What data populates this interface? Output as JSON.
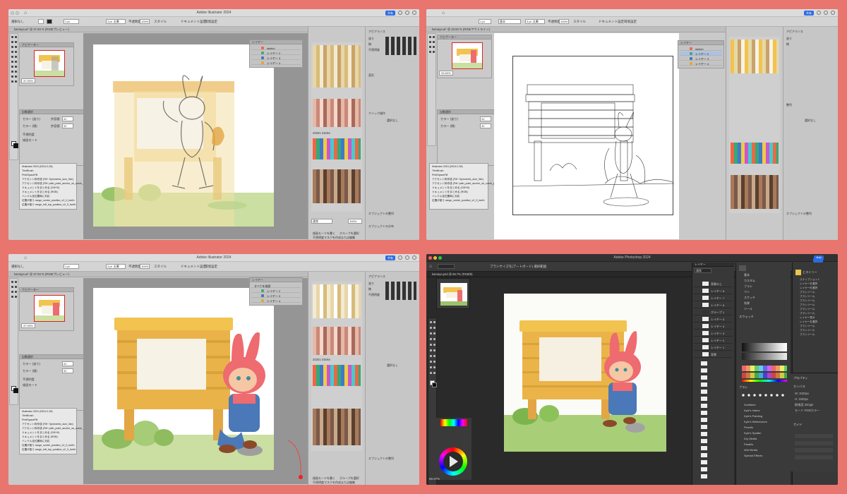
{
  "illustrator": {
    "app_title": "Adobe Illustrator 2024",
    "share_label": "共有",
    "selection_label": "選択なし",
    "stroke_value": "1 pt",
    "brush_label": "3 pt. 丸筆",
    "opacity_label": "不透明度",
    "opacity_value": "100%",
    "style_label": "スタイル",
    "doc_settings": "ドキュメント設定",
    "env_settings": "環境設定",
    "w2_stroke_label": "基本",
    "tab_label": "kamaya.ai* @ 37.93 % (RGB/プレビュー)",
    "tab_label_w2": "kamaya.ai* @ 33.83 % (RGB/アウトライン)",
    "nav_title": "ナビゲーター",
    "zoom_w1": "37.93%",
    "zoom_w2": "33.83%",
    "zoom_w3": "37.93%",
    "color_panel_title": "自動選択",
    "color_row1": "カラー (塗り)",
    "color_row2": "カラー (線)",
    "tolerance": "許容値",
    "tol1": "41",
    "tol2": "32",
    "opt1": "不透明度",
    "opt2": "描画モード",
    "layers_title": "レイヤー",
    "layers": [
      "sketch",
      "レイヤー 2",
      "レイヤー 3",
      "レイヤー 4"
    ],
    "layers_w3": [
      "すべてを検索",
      "レイヤー 2",
      "レイヤー 3",
      "レイヤー 4"
    ],
    "history": [
      "Illustrator 2024 (2024-2-28)",
      "TrimBrush",
      "PrintSpaceFill",
      "アクセント枠作成 (Fill+ Symmetric_size_3ke)",
      "アクセント枠作成 (Fill+ path_point_anchor_ok_curve_position)",
      "ドキュメントをまとめる (CMYK)",
      "ドキュメントをまとめる (RGB)",
      "ハンドル定位置時に対応",
      "位置が揃う range_centre_position_v2_0_berth",
      "位置が揃う range_left_top_position_v2_0_berth",
      "画像トレース"
    ],
    "props": {
      "section": "アピアランス",
      "fill": "塗り",
      "stroke": "線",
      "opacity_row": "不透明度",
      "transform": "変形",
      "align": "整列",
      "quick_actions": "クイック操作",
      "group_edit": "描画モードを書く",
      "group_btn": "グループを選択",
      "mask_btn": "不透明度マスクを作成または編集",
      "none_selected": "選択なし",
      "object_align": "オブジェクトの整列",
      "distribute": "オブジェクトの分布",
      "align_to": "整列"
    },
    "swatch_title": "スウォッチ",
    "swatch_lib": "20201 Stroke",
    "blend_mode": "通常",
    "blend_opacity": "100%"
  },
  "photoshop": {
    "app_title": "Adobe Photoshop 2024",
    "tab_label": "kamaya.psd @ 66.7% (RGB/8)",
    "tab_label2": "ブラシサイズを(アートボード) 選択範囲",
    "zoom": "66.67%",
    "layers_title": "レイヤー",
    "blend": "通常",
    "layers": [
      "背景の上",
      "レイヤー 8",
      "レイヤー 7",
      "レイヤー 6",
      "グループ 1",
      "レイヤー 5",
      "レイヤー 4",
      "レイヤー 3",
      "レイヤー 2",
      "レイヤー 1",
      "背景"
    ],
    "folders": [
      "基本",
      "カスタム",
      "ブラシ",
      "ペン",
      "スケッチ",
      "効果",
      "ツール"
    ],
    "props_title": "プロパティ",
    "props": {
      "w": "W: 2000px",
      "h": "H: 1600px",
      "res": "解像度 300ppi",
      "mode": "モード RGBカラー",
      "canvas": "カンバス",
      "guide": "ガイド"
    },
    "color_title": "カラー",
    "swatch_title": "スウォッチ",
    "brush_title": "ブラシ",
    "brush_groups": [
      "Scribbles",
      "Kyle's Inkers",
      "Kyle's Painting",
      "Kyle's Watercolors",
      "Pencils",
      "Kyle's Spatter",
      "Dry Media",
      "Pastels",
      "Wet Media",
      "Special Effects"
    ],
    "right_history_title": "ヒストリー",
    "right_history": [
      "スナップショット",
      "レイヤーを選択",
      "レイヤーを選択",
      "ブラシツール",
      "ブラシツール",
      "ブラシツール",
      "ブラシツール",
      "ブラシツール",
      "ブラシツール",
      "レイヤー表示",
      "レイヤーを選択",
      "ブラシツール",
      "ブラシツール",
      "ブラシツール"
    ],
    "status_text": "66.67%"
  },
  "colors": {
    "bg": "#E9756F",
    "board_yellow": "#F2C34E",
    "board_dark": "#D9A33A",
    "post": "#E2A644",
    "bunny_pink": "#EE6B70",
    "overalls": "#4A78B8",
    "grass": "#9BC36A",
    "ground": "#CADFA1",
    "selection_blue": "#A9C3E6"
  }
}
